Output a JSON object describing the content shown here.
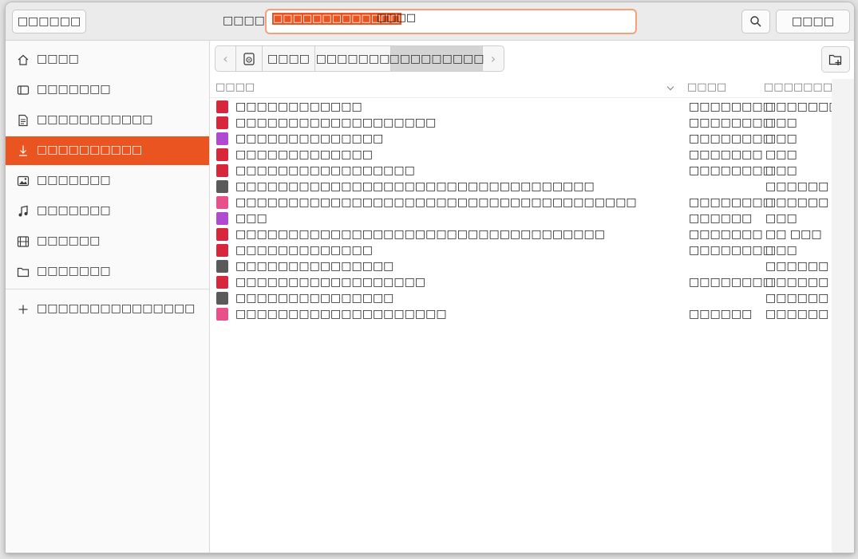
{
  "header": {
    "cancel_label": "□□□□□□",
    "name_label": "□□□□",
    "name_selected": "□□□□□□□□□□□□□",
    "name_rest": "□□□□",
    "open_label": "□□□□"
  },
  "sidebar": {
    "items": [
      {
        "label": "□□□□",
        "icon": "home-icon"
      },
      {
        "label": "□□□□□□□",
        "icon": "desktop-icon"
      },
      {
        "label": "□□□□□□□□□□□",
        "icon": "documents-icon"
      },
      {
        "label": "□□□□□□□□□□",
        "icon": "downloads-icon",
        "active": true
      },
      {
        "label": "□□□□□□□",
        "icon": "pictures-icon"
      },
      {
        "label": "□□□□□□□",
        "icon": "music-icon"
      },
      {
        "label": "□□□□□□",
        "icon": "videos-icon"
      },
      {
        "label": "□□□□□□□",
        "icon": "folder-icon"
      }
    ],
    "other_locations_label": "□□□□□□□□□□□□□□□"
  },
  "pathbar": {
    "segments": [
      "□□□□",
      "□□□□□□□",
      "□□□□□□□□□"
    ]
  },
  "columns": {
    "name": "□□□□",
    "size": "□□□□",
    "modified": "□□□□□□□□"
  },
  "files": [
    {
      "name": "□□□□□□□□□□□□",
      "size": "□□□□□□□□",
      "modified": "□□□□□□□",
      "type": "pdf"
    },
    {
      "name": "□□□□□□□□□□□□□□□□□□□",
      "size": "□□□□□□□□",
      "modified": "□□□",
      "type": "pdf"
    },
    {
      "name": "□□□□□□□□□□□□□□",
      "size": "□□□□□□□□",
      "modified": "□□□",
      "type": "image"
    },
    {
      "name": "□□□□□□□□□□□□□",
      "size": "□□□□□□□",
      "modified": "□□□",
      "type": "pdf"
    },
    {
      "name": "□□□□□□□□□□□□□□□□□",
      "size": "□□□□□□□□",
      "modified": "□□□",
      "type": "pdf"
    },
    {
      "name": "□□□□□□□□□□□□□□□□□□□□□□□□□□□□□□□□□□",
      "size": "",
      "modified": "□□□□□□",
      "type": "folder"
    },
    {
      "name": "□□□□□□□□□□□□□□□□□□□□□□□□□□□□□□□□□□□□□□",
      "size": "□□□□□□□□",
      "modified": "□□□□□□",
      "type": "archive"
    },
    {
      "name": "□□□",
      "size": "□□□□□□",
      "modified": "□□□",
      "type": "image"
    },
    {
      "name": "□□□□□□□□□□□□□□□□□□□□□□□□□□□□□□□□□□□",
      "size": "□□□□□□□",
      "modified": "□□ □□□",
      "type": "pdf"
    },
    {
      "name": "□□□□□□□□□□□□□",
      "size": "□□□□□□□□",
      "modified": "□□□",
      "type": "pdf"
    },
    {
      "name": "□□□□□□□□□□□□□□□",
      "size": "",
      "modified": "□□□□□□",
      "type": "folder"
    },
    {
      "name": "□□□□□□□□□□□□□□□□□□",
      "size": "□□□□□□□□",
      "modified": "□□□□□□",
      "type": "pdf"
    },
    {
      "name": "□□□□□□□□□□□□□□□",
      "size": "",
      "modified": "□□□□□□",
      "type": "folder"
    },
    {
      "name": "□□□□□□□□□□□□□□□□□□□□",
      "size": "□□□□□□",
      "modified": "□□□□□□",
      "type": "archive"
    }
  ],
  "colors": {
    "accent": "#e95420",
    "pdf": "#d6283a",
    "image": "#b04ad0",
    "folder": "#5a5a5a",
    "archive": "#e8508c"
  }
}
